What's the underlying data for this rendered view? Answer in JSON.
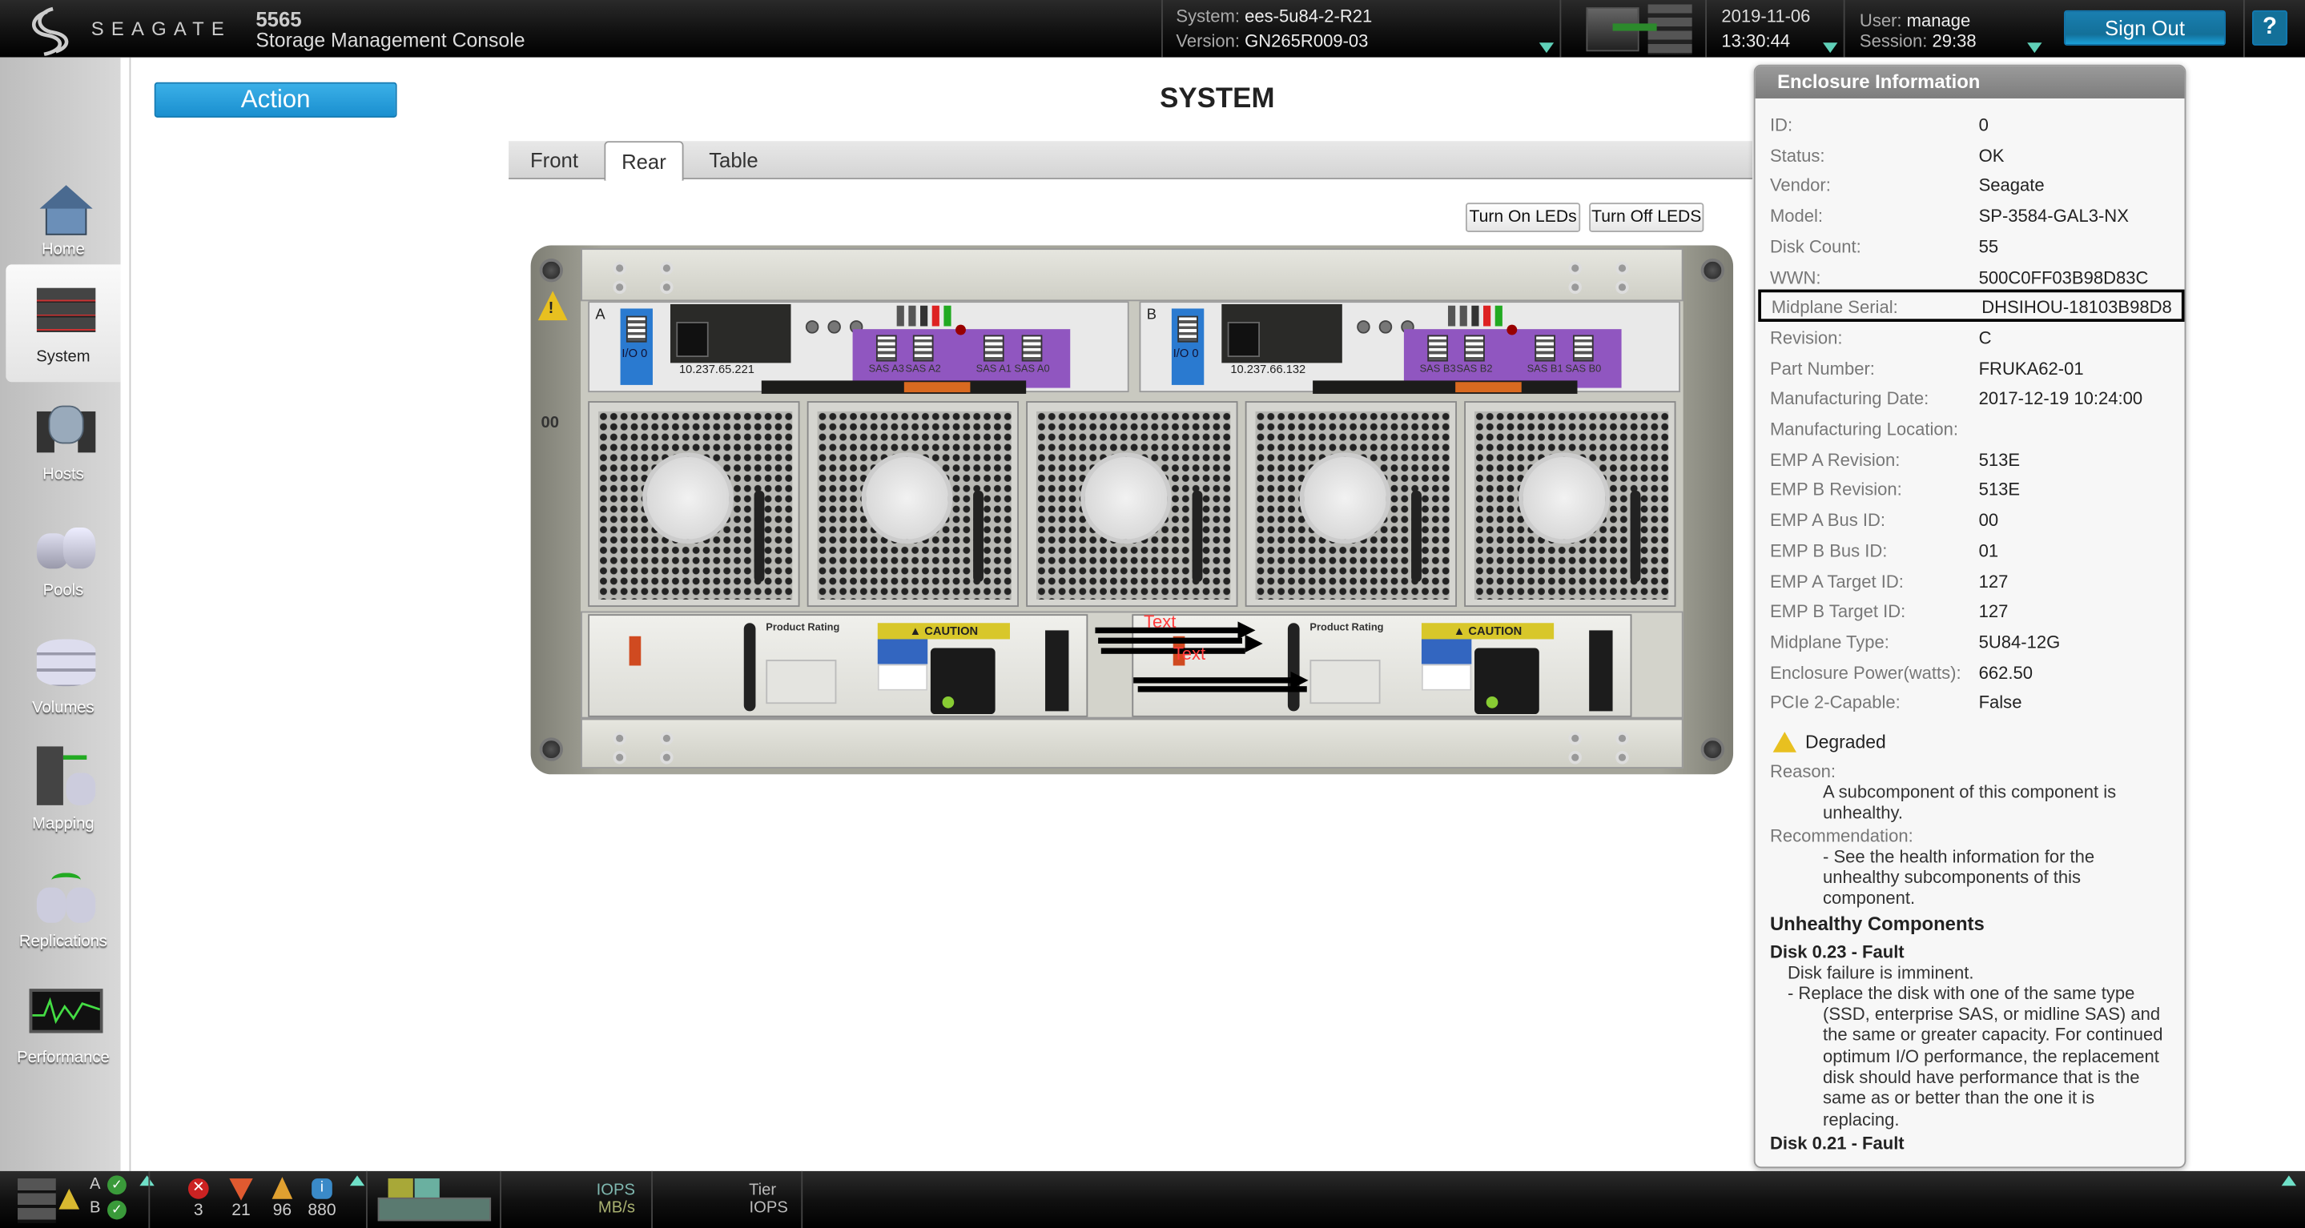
{
  "header": {
    "brand": "SEAGATE",
    "model": "5565",
    "app_title": "Storage Management Console",
    "system_label": "System:",
    "system_value": "ees-5u84-2-R21",
    "version_label": "Version:",
    "version_value": "GN265R009-03",
    "date": "2019-11-06",
    "time": "13:30:44",
    "user_label": "User:",
    "user_value": "manage",
    "session_label": "Session:",
    "session_value": "29:38",
    "sign_out": "Sign Out",
    "help": "?"
  },
  "sidebar": {
    "items": [
      {
        "label": "Home",
        "icon": "home-icon"
      },
      {
        "label": "System",
        "icon": "system-icon",
        "selected": true
      },
      {
        "label": "Hosts",
        "icon": "hosts-icon"
      },
      {
        "label": "Pools",
        "icon": "pools-icon"
      },
      {
        "label": "Volumes",
        "icon": "volumes-icon"
      },
      {
        "label": "Mapping",
        "icon": "mapping-icon"
      },
      {
        "label": "Replications",
        "icon": "replications-icon"
      },
      {
        "label": "Performance",
        "icon": "performance-icon"
      }
    ]
  },
  "main": {
    "action_label": "Action",
    "page_title": "SYSTEM",
    "tabs": [
      {
        "label": "Front"
      },
      {
        "label": "Rear",
        "selected": true
      },
      {
        "label": "Table"
      }
    ],
    "turn_on_leds": "Turn On LEDs",
    "turn_off_leds": "Turn Off LEDS"
  },
  "enclosure": {
    "enclosure_id_label": "00",
    "controllers": [
      {
        "name": "A",
        "io_label": "I/O 0",
        "ip": "10.237.65.221",
        "sas_ports": [
          "SAS A3",
          "SAS A2",
          "SAS A1",
          "SAS A0"
        ]
      },
      {
        "name": "B",
        "io_label": "I/O 0",
        "ip": "10.237.66.132",
        "sas_ports": [
          "SAS B3",
          "SAS B2",
          "SAS B1",
          "SAS B0"
        ]
      }
    ],
    "psu_rating_label": "Product Rating",
    "psu_caution_label": "CAUTION",
    "annotations": [
      "Text",
      "Text"
    ],
    "colors": {
      "io_port": "#2a7ad0",
      "sas_module": "#9056c0",
      "annotation": "#ff3b3b",
      "warning": "#e8c020"
    }
  },
  "enclosure_info": {
    "title": "Enclosure Information",
    "fields": [
      {
        "label": "ID:",
        "value": "0"
      },
      {
        "label": "Status:",
        "value": "OK"
      },
      {
        "label": "Vendor:",
        "value": "Seagate"
      },
      {
        "label": "Model:",
        "value": "SP-3584-GAL3-NX"
      },
      {
        "label": "Disk Count:",
        "value": "55"
      },
      {
        "label": "WWN:",
        "value": "500C0FF03B98D83C"
      },
      {
        "label": "Midplane Serial:",
        "value": "DHSIHOU-18103B98D8",
        "highlighted": true
      },
      {
        "label": "Revision:",
        "value": "C"
      },
      {
        "label": "Part Number:",
        "value": "FRUKA62-01"
      },
      {
        "label": "Manufacturing Date:",
        "value": "2017-12-19 10:24:00"
      },
      {
        "label": "Manufacturing Location:",
        "value": ""
      },
      {
        "label": "EMP A Revision:",
        "value": "513E"
      },
      {
        "label": "EMP B Revision:",
        "value": "513E"
      },
      {
        "label": "EMP A Bus ID:",
        "value": "00"
      },
      {
        "label": "EMP B Bus ID:",
        "value": "01"
      },
      {
        "label": "EMP A Target ID:",
        "value": "127"
      },
      {
        "label": "EMP B Target ID:",
        "value": "127"
      },
      {
        "label": "Midplane Type:",
        "value": "5U84-12G"
      },
      {
        "label": "Enclosure Power(watts):",
        "value": "662.50"
      },
      {
        "label": "PCIe 2-Capable:",
        "value": "False"
      }
    ],
    "health": "Degraded",
    "reason_label": "Reason:",
    "reason_lines": [
      "A subcomponent of this component is",
      "unhealthy."
    ],
    "recommendation_label": "Recommendation:",
    "recommendation_lines": [
      "- See the health information for the",
      "unhealthy subcomponents of this",
      "component."
    ],
    "unhealthy_title": "Unhealthy Components",
    "components": [
      {
        "title": "Disk 0.23 - Fault",
        "reason": "Disk failure is imminent.",
        "rec_first": "- Replace the disk with one of the same type",
        "rec_lines": [
          "(SSD, enterprise SAS, or midline SAS) and",
          "the same or greater capacity. For continued",
          "optimum I/O performance, the replacement",
          "disk should have performance that is the",
          "same as or better than the one it is",
          "replacing."
        ]
      },
      {
        "title": "Disk 0.21 - Fault"
      }
    ]
  },
  "footer": {
    "controller_a": "A",
    "controller_b": "B",
    "critical_count": "3",
    "error_count": "21",
    "warning_count": "96",
    "info_count": "880",
    "iops_label": "IOPS",
    "mbs_label": "MB/s",
    "tier_label": "Tier",
    "tier_iops_label": "IOPS"
  }
}
